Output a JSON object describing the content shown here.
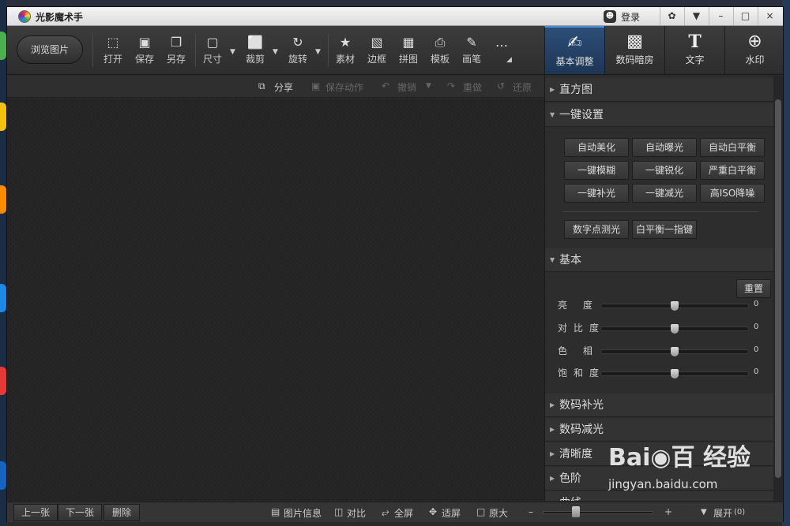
{
  "window": {
    "title": "光影魔术手",
    "login": "登录",
    "minimize": "–",
    "maximize": "□",
    "close": "×"
  },
  "toolbar": {
    "browse": "浏览图片",
    "tools": [
      {
        "label": "打开",
        "icon": "⬚"
      },
      {
        "label": "保存",
        "icon": "▣"
      },
      {
        "label": "另存",
        "icon": "❐"
      },
      {
        "label": "尺寸",
        "icon": "▢"
      },
      {
        "label": "裁剪",
        "icon": "⬜"
      },
      {
        "label": "旋转",
        "icon": "↻"
      },
      {
        "label": "素材",
        "icon": "★"
      },
      {
        "label": "边框",
        "icon": "▧"
      },
      {
        "label": "拼图",
        "icon": "▦"
      },
      {
        "label": "模板",
        "icon": "⎙"
      },
      {
        "label": "画笔",
        "icon": "✎"
      }
    ],
    "more": "…",
    "tabs": [
      {
        "label": "基本调整",
        "icon": "✍"
      },
      {
        "label": "数码暗房",
        "icon": "▩"
      },
      {
        "label": "文字",
        "icon": "T"
      },
      {
        "label": "水印",
        "icon": "⊕"
      }
    ]
  },
  "actions": {
    "share": "分享",
    "save_action": "保存动作",
    "undo": "撤销",
    "redo": "重做",
    "restore": "还原"
  },
  "panel": {
    "histogram": "直方图",
    "oneclick": {
      "title": "一键设置",
      "buttons": [
        "自动美化",
        "自动曝光",
        "自动白平衡",
        "一键模糊",
        "一键锐化",
        "严重白平衡",
        "一键补光",
        "一键减光",
        "高ISO降噪"
      ],
      "extra": [
        "数字点测光",
        "白平衡一指键"
      ]
    },
    "basic": {
      "title": "基本",
      "reset": "重置",
      "sliders": [
        {
          "label": "亮 度",
          "value": 0
        },
        {
          "label": "对比度",
          "value": 0
        },
        {
          "label": "色 相",
          "value": 0
        },
        {
          "label": "饱和度",
          "value": 0
        }
      ]
    },
    "sections": [
      "数码补光",
      "数码减光",
      "清晰度",
      "色阶",
      "曲线"
    ]
  },
  "status": {
    "prev": "上一张",
    "next": "下一张",
    "delete": "删除",
    "info": "图片信息",
    "compare": "对比",
    "fullscreen": "全屏",
    "fit": "适屏",
    "original": "原大",
    "zoom_minus": "–",
    "zoom_plus": "+",
    "expand": "展开",
    "expand_count": "(0)",
    "zoom_level": 0.3
  },
  "watermark": {
    "logo": "Bai◉百 经验",
    "url": "jingyan.baidu.com"
  },
  "colors": {
    "accent": "#2c4e77",
    "panel": "#2d2d2d"
  }
}
